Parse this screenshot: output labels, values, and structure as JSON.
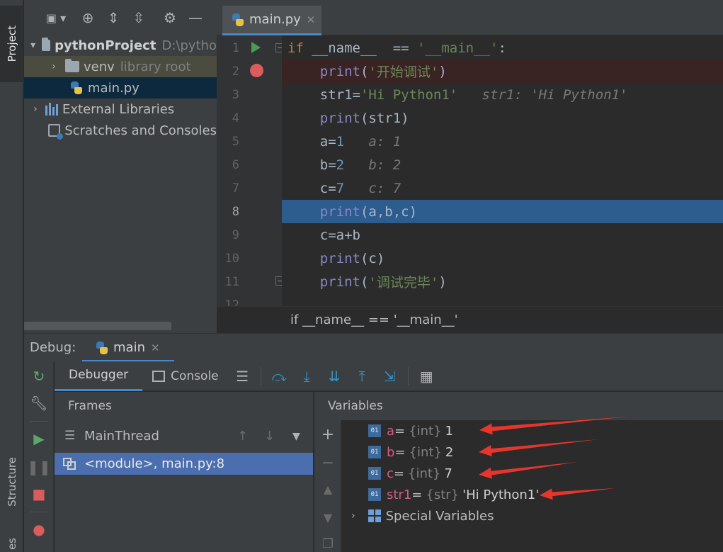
{
  "tool_strip": {
    "project": "Project",
    "structure": "Structure",
    "favorites": "es"
  },
  "project_tree": {
    "root": {
      "name": "pythonProject",
      "path": "D:\\pytho"
    },
    "venv": {
      "name": "venv",
      "hint": "library root"
    },
    "main_file": "main.py",
    "external": "External Libraries",
    "scratches": "Scratches and Consoles"
  },
  "editor": {
    "tab_label": "main.py",
    "line_numbers": [
      "1",
      "2",
      "3",
      "4",
      "5",
      "6",
      "7",
      "8",
      "9",
      "10",
      "11",
      "12"
    ],
    "current_line": 8,
    "breadcrumb": "if __name__ == '__main__'"
  },
  "code_lines": [
    {
      "parts": [
        [
          "kw",
          "if "
        ],
        [
          "dunder",
          "__name__"
        ],
        [
          "",
          "  == "
        ],
        [
          "str",
          "'__main__'"
        ],
        [
          "",
          ":"
        ]
      ]
    },
    {
      "parts": [
        [
          "",
          "    "
        ],
        [
          "fn",
          "print"
        ],
        [
          "",
          "("
        ],
        [
          "str",
          "'开始调试'"
        ],
        [
          "",
          ")"
        ]
      ]
    },
    {
      "parts": [
        [
          "",
          "    str1="
        ],
        [
          "str",
          "'Hi Python1'"
        ],
        [
          "inl",
          "   str1: 'Hi Python1'"
        ]
      ]
    },
    {
      "parts": [
        [
          "",
          "    "
        ],
        [
          "fn",
          "print"
        ],
        [
          "",
          "(str1)"
        ]
      ]
    },
    {
      "parts": [
        [
          "",
          "    a="
        ],
        [
          "num",
          "1"
        ],
        [
          "inl",
          "   a: 1"
        ]
      ]
    },
    {
      "parts": [
        [
          "",
          "    b="
        ],
        [
          "num",
          "2"
        ],
        [
          "inl",
          "   b: 2"
        ]
      ]
    },
    {
      "parts": [
        [
          "",
          "    c="
        ],
        [
          "num",
          "7"
        ],
        [
          "inl",
          "   c: 7"
        ]
      ]
    },
    {
      "parts": [
        [
          "",
          "    "
        ],
        [
          "fn",
          "print"
        ],
        [
          "",
          "(a,b,c)"
        ]
      ]
    },
    {
      "parts": [
        [
          "",
          "    c=a+b"
        ]
      ]
    },
    {
      "parts": [
        [
          "",
          "    "
        ],
        [
          "fn",
          "print"
        ],
        [
          "",
          "(c)"
        ]
      ]
    },
    {
      "parts": [
        [
          "",
          "    "
        ],
        [
          "fn",
          "print"
        ],
        [
          "",
          "("
        ],
        [
          "str",
          "'调试完毕'"
        ],
        [
          "",
          ")"
        ]
      ]
    }
  ],
  "debug": {
    "title": "Debug:",
    "session": "main",
    "tabs": {
      "debugger": "Debugger",
      "console": "Console"
    },
    "frames_title": "Frames",
    "thread": "MainThread",
    "frame": "<module>, main.py:8",
    "variables_title": "Variables",
    "variables": [
      {
        "name": "a",
        "type": "{int}",
        "value": "1"
      },
      {
        "name": "b",
        "type": "{int}",
        "value": "2"
      },
      {
        "name": "c",
        "type": "{int}",
        "value": "7"
      },
      {
        "name": "str1",
        "type": "{str}",
        "value": "'Hi Python1'"
      }
    ],
    "special": "Special Variables"
  },
  "colors": {
    "accent": "#4a88c7",
    "arrow": "#e8352c",
    "execution_line": "#2d5c8f"
  }
}
